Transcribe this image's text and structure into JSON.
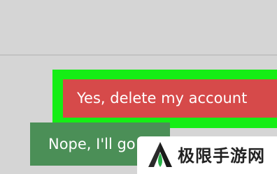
{
  "dialog": {
    "confirm_label": "Yes, delete my account",
    "cancel_label": "Nope, I'll go back"
  },
  "colors": {
    "background": "#d5d5d5",
    "highlight": "#15ee15",
    "confirm_bg": "#d64a4a",
    "cancel_bg": "#4b8f57"
  },
  "watermark": {
    "text": "极限手游网",
    "icon": "mountain-logo-icon"
  }
}
